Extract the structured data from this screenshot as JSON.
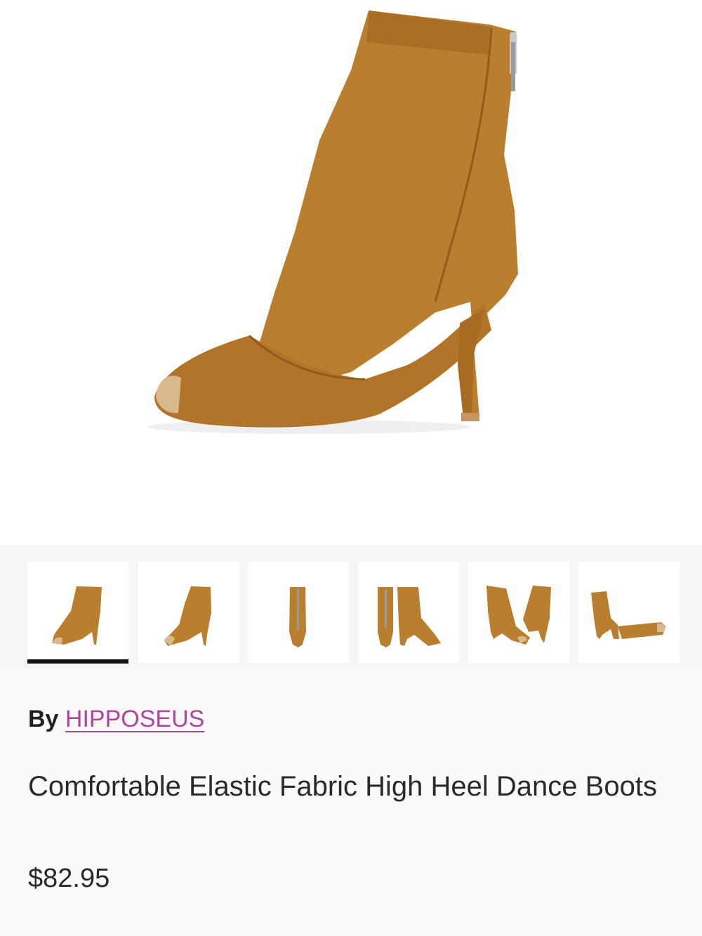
{
  "product": {
    "brand_prefix": "By",
    "brand": "HIPPOSEUS",
    "title": "Comfortable Elastic Fabric High Heel Dance Boots",
    "price": "$82.95"
  },
  "gallery": {
    "main_image": "boot-side-view",
    "thumbnails": [
      "boot-side-left",
      "boot-side-angle",
      "boot-back",
      "boot-pair-front-side",
      "boot-pair-v",
      "boot-pair-lying"
    ],
    "selected_index": 0
  },
  "colors": {
    "boot": "#b97f2e",
    "boot_shadow": "#8f5c1c",
    "insole": "#d8b98d",
    "brand_link": "#b0459e"
  }
}
